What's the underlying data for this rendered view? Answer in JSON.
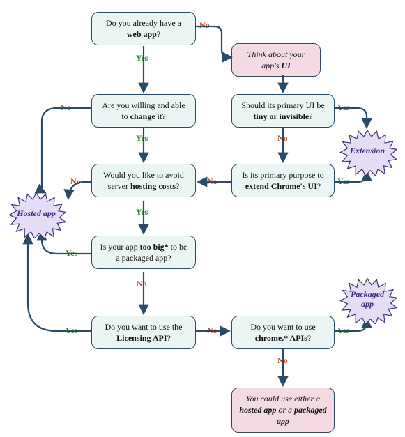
{
  "chart_data": {
    "type": "flowchart",
    "title": "",
    "nodes": [
      {
        "id": "q_webapp",
        "text_parts": [
          "Do you already have a ",
          "web app",
          "?"
        ],
        "kind": "question"
      },
      {
        "id": "think_ui",
        "text_parts": [
          "Think about your app's ",
          "UI"
        ],
        "kind": "note"
      },
      {
        "id": "q_change",
        "text_parts": [
          "Are you willing and able to ",
          "change",
          " it?"
        ],
        "kind": "question"
      },
      {
        "id": "q_tiny",
        "text_parts": [
          "Should its primary UI be ",
          "tiny or invisible",
          "?"
        ],
        "kind": "question"
      },
      {
        "id": "q_hosting",
        "text_parts": [
          "Would you like to avoid server ",
          "hosting costs",
          "?"
        ],
        "kind": "question"
      },
      {
        "id": "q_extend",
        "text_parts": [
          "Is its primary purpose to ",
          "extend Chrome's UI",
          "?"
        ],
        "kind": "question"
      },
      {
        "id": "q_toobig",
        "text_parts": [
          "Is your app ",
          "too big*",
          " to be a packaged app?"
        ],
        "kind": "question"
      },
      {
        "id": "q_licensing",
        "text_parts": [
          "Do you want to use the ",
          "Licensing API",
          "?"
        ],
        "kind": "question"
      },
      {
        "id": "q_chromeapi",
        "text_parts": [
          "Do you want to use ",
          "chrome.* APIs",
          "?"
        ],
        "kind": "question"
      },
      {
        "id": "either",
        "text_parts": [
          "You could use either a ",
          "hosted app",
          " or a ",
          "packaged app"
        ],
        "kind": "note"
      },
      {
        "id": "r_hosted",
        "label": "Hosted app",
        "kind": "result"
      },
      {
        "id": "r_extension",
        "label": "Extension",
        "kind": "result"
      },
      {
        "id": "r_packaged",
        "label": "Packaged app",
        "kind": "result"
      }
    ],
    "edges": [
      {
        "from": "q_webapp",
        "to": "think_ui",
        "label": "No"
      },
      {
        "from": "q_webapp",
        "to": "q_change",
        "label": "Yes"
      },
      {
        "from": "think_ui",
        "to": "q_tiny",
        "label": ""
      },
      {
        "from": "q_change",
        "to": "r_hosted",
        "label": "No"
      },
      {
        "from": "q_change",
        "to": "q_hosting",
        "label": "Yes"
      },
      {
        "from": "q_tiny",
        "to": "r_extension",
        "label": "Yes"
      },
      {
        "from": "q_tiny",
        "to": "q_extend",
        "label": "No"
      },
      {
        "from": "q_extend",
        "to": "r_extension",
        "label": "Yes"
      },
      {
        "from": "q_extend",
        "to": "q_hosting",
        "label": "No"
      },
      {
        "from": "q_hosting",
        "to": "r_hosted",
        "label": "No"
      },
      {
        "from": "q_hosting",
        "to": "q_toobig",
        "label": "Yes"
      },
      {
        "from": "q_toobig",
        "to": "r_hosted",
        "label": "Yes"
      },
      {
        "from": "q_toobig",
        "to": "q_licensing",
        "label": "No"
      },
      {
        "from": "q_licensing",
        "to": "r_hosted",
        "label": "Yes"
      },
      {
        "from": "q_licensing",
        "to": "q_chromeapi",
        "label": "No"
      },
      {
        "from": "q_chromeapi",
        "to": "r_packaged",
        "label": "Yes"
      },
      {
        "from": "q_chromeapi",
        "to": "either",
        "label": "No"
      }
    ]
  },
  "labels": {
    "yes": "Yes",
    "no": "No"
  }
}
